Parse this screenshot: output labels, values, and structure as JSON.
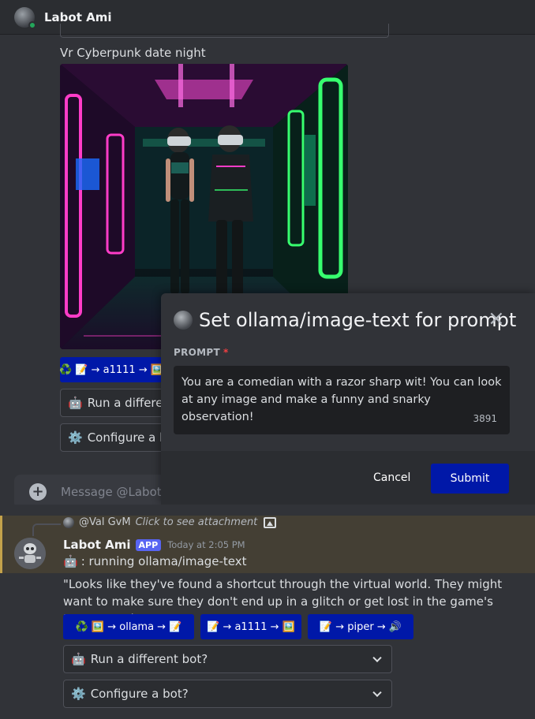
{
  "top": {
    "header": {
      "bot_name": "Labot Ami"
    },
    "caption": "Vr Cyberpunk date night",
    "image_alt": "VR cyberpunk date night scene",
    "image_buttons": [
      {
        "label": "♻️ 📝 → a1111 → 🖼️"
      }
    ],
    "dropdowns": [
      {
        "emoji": "🤖",
        "label": "Run a different bot?"
      },
      {
        "emoji": "⚙️",
        "label": "Configure a bot?"
      }
    ],
    "message_placeholder": "Message @Labot Ami",
    "modal": {
      "title": "Set ollama/image-text for prompt",
      "field_label": "PROMPT",
      "required_mark": "*",
      "prompt_text": "You are a comedian with a razor sharp wit! You can look at any image and make a funny and snarky observation!",
      "char_count": "3891",
      "cancel_label": "Cancel",
      "submit_label": "Submit"
    }
  },
  "bottom": {
    "reply": {
      "author": "@Val GvM",
      "link_text": "Click to see attachment"
    },
    "message": {
      "author": "Labot Ami",
      "tag": "APP",
      "timestamp": "Today at 2:05 PM",
      "status_emoji": "🤖",
      "status_text": ": running ollama/image-text",
      "body": "\"Looks like they've found a shortcut through the virtual world. They might want to make sure they don't end up in a glitch or get lost in the game's Easter egg hunt!\""
    },
    "buttons": [
      {
        "label": "♻️ 🖼️ → ollama → 📝"
      },
      {
        "label": "📝 → a1111 → 🖼️"
      },
      {
        "label": "📝 → piper → 🔊"
      }
    ],
    "dropdowns": [
      {
        "emoji": "🤖",
        "label": "Run a different bot?"
      },
      {
        "emoji": "⚙️",
        "label": "Configure a bot?"
      }
    ]
  },
  "colors": {
    "button_blue": "#0018a8",
    "app_tag": "#5865f2",
    "online": "#23a55a",
    "highlight_bg": "#443f34",
    "highlight_bar": "#c4a24b"
  }
}
